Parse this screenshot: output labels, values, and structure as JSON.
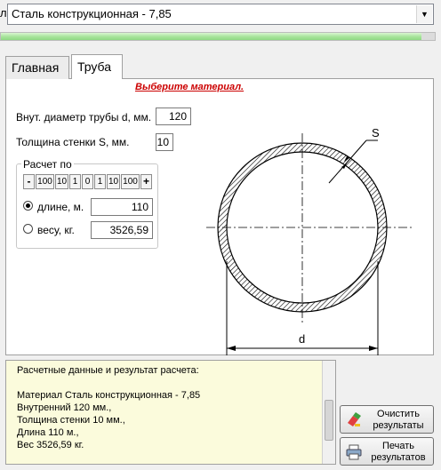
{
  "top": {
    "label_fragment": "л",
    "material_value": "Сталь конструкционная - 7,85",
    "progress": 0.97
  },
  "tabs": [
    {
      "label": "Главная"
    },
    {
      "label": "Труба"
    }
  ],
  "form": {
    "warning": "Выберите материал.",
    "inner_diameter_label": "Внут. диаметр трубы d, мм.",
    "inner_diameter_value": "120",
    "wall_label": "Толщина стенки S, мм.",
    "wall_value": "10",
    "calc_group_label": "Расчет по",
    "step_buttons": [
      "-",
      "100",
      "10",
      "1",
      "0",
      "1",
      "10",
      "100",
      "+"
    ],
    "by_length_label": "длине, м.",
    "by_length_value": "110",
    "by_weight_label": "весу, кг.",
    "by_weight_value": "3526,59",
    "selected": "length"
  },
  "drawing": {
    "wall_label": "S",
    "diameter_label": "d"
  },
  "results": {
    "lines": [
      "Расчетные данные и результат расчета:",
      "",
      "Материал Сталь конструкционная - 7,85",
      "Внутренний 120 мм.,",
      "Толщина стенки 10 мм.,",
      "Длина 110 м.,",
      "Вес 3526,59 кг."
    ]
  },
  "buttons": {
    "clear_line1": "Очистить",
    "clear_line2": "результаты",
    "print_line1": "Печать",
    "print_line2": "результатов"
  }
}
